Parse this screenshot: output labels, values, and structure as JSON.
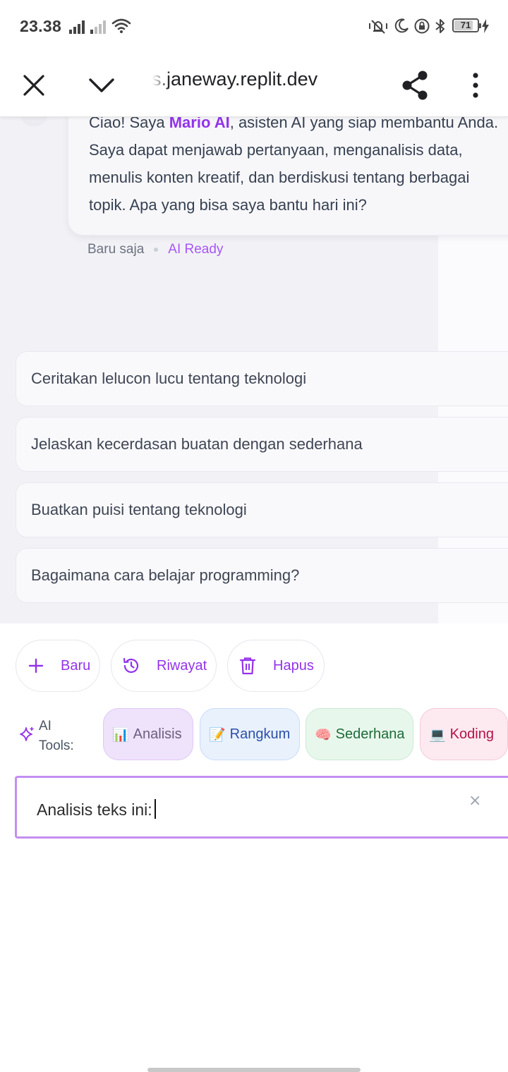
{
  "status_bar": {
    "time": "23.38",
    "battery": "71",
    "icons": [
      "signal-icon",
      "signal-weak-icon",
      "wifi-icon",
      "vibrate-icon",
      "moon-icon",
      "lock-rotation-icon",
      "bluetooth-icon",
      "battery-icon",
      "charging-icon"
    ]
  },
  "browser": {
    "url": "s.janeway.replit.dev",
    "icons": [
      "close-icon",
      "chevron-down-icon",
      "share-icon",
      "more-vertical-icon"
    ]
  },
  "chat": {
    "lines": [
      {
        "before": "Ciao! Saya ",
        "brand": "Mario AI",
        "after": ", asisten AI yang siap membantu Anda."
      },
      {
        "text": "Saya dapat menjawab pertanyaan, menganalisis data,"
      },
      {
        "text": "menulis konten kreatif, dan berdiskusi tentang berbagai"
      },
      {
        "text": "topik. Apa yang bisa saya bantu hari ini?"
      }
    ],
    "timestamp": "Baru saja",
    "status": "AI Ready"
  },
  "suggestions": [
    "Ceritakan lelucon lucu tentang teknologi",
    "Jelaskan kecerdasan buatan dengan sederhana",
    "Buatkan puisi tentang teknologi",
    "Bagaimana cara belajar programming?"
  ],
  "actions": {
    "new": "Baru",
    "history": "Riwayat",
    "clear": "Hapus"
  },
  "tools": {
    "label_line1": "AI",
    "label_line2": "Tools:",
    "chips": [
      {
        "emoji": "📊",
        "label": "Analisis"
      },
      {
        "emoji": "📝",
        "label": "Rangkum"
      },
      {
        "emoji": "🧠",
        "label": "Sederhana"
      },
      {
        "emoji": "💻",
        "label": "Koding"
      }
    ]
  },
  "input": {
    "value": "Analisis teks ini:",
    "clear_symbol": "×"
  },
  "colors": {
    "accent": "#9333ea",
    "accent_light": "#a855f7",
    "input_border": "#c48ff0"
  }
}
